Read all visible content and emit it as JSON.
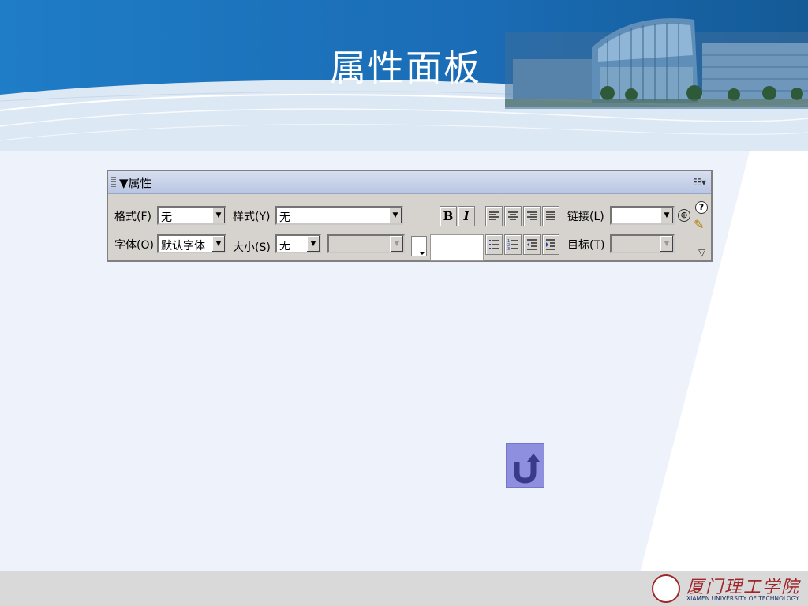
{
  "slide": {
    "title": "属性面板",
    "institution_cn": "厦门理工学院",
    "institution_en": "XIAMEN UNIVERSITY OF TECHNOLOGY"
  },
  "panel": {
    "title": "▼属性",
    "row1": {
      "format_label": "格式(F)",
      "format_value": "无",
      "style_label": "样式(Y)",
      "style_value": "无",
      "link_label": "链接(L)",
      "link_value": ""
    },
    "row2": {
      "font_label": "字体(O)",
      "font_value": "默认字体",
      "size_label": "大小(S)",
      "size_value": "无",
      "size_unit_value": "",
      "color_value": "",
      "target_label": "目标(T)",
      "target_value": ""
    },
    "buttons": {
      "bold": "B",
      "italic": "I",
      "help": "?"
    }
  },
  "colors": {
    "header_blue": "#1a6fb8",
    "panel_gray": "#d6d3ce",
    "back_button": "#8f8fe0",
    "logo_red": "#a0262a"
  },
  "icons": {
    "back": "u-turn-arrow-icon",
    "help": "question-icon",
    "edit": "pencil-icon",
    "target": "crosshair-icon"
  }
}
